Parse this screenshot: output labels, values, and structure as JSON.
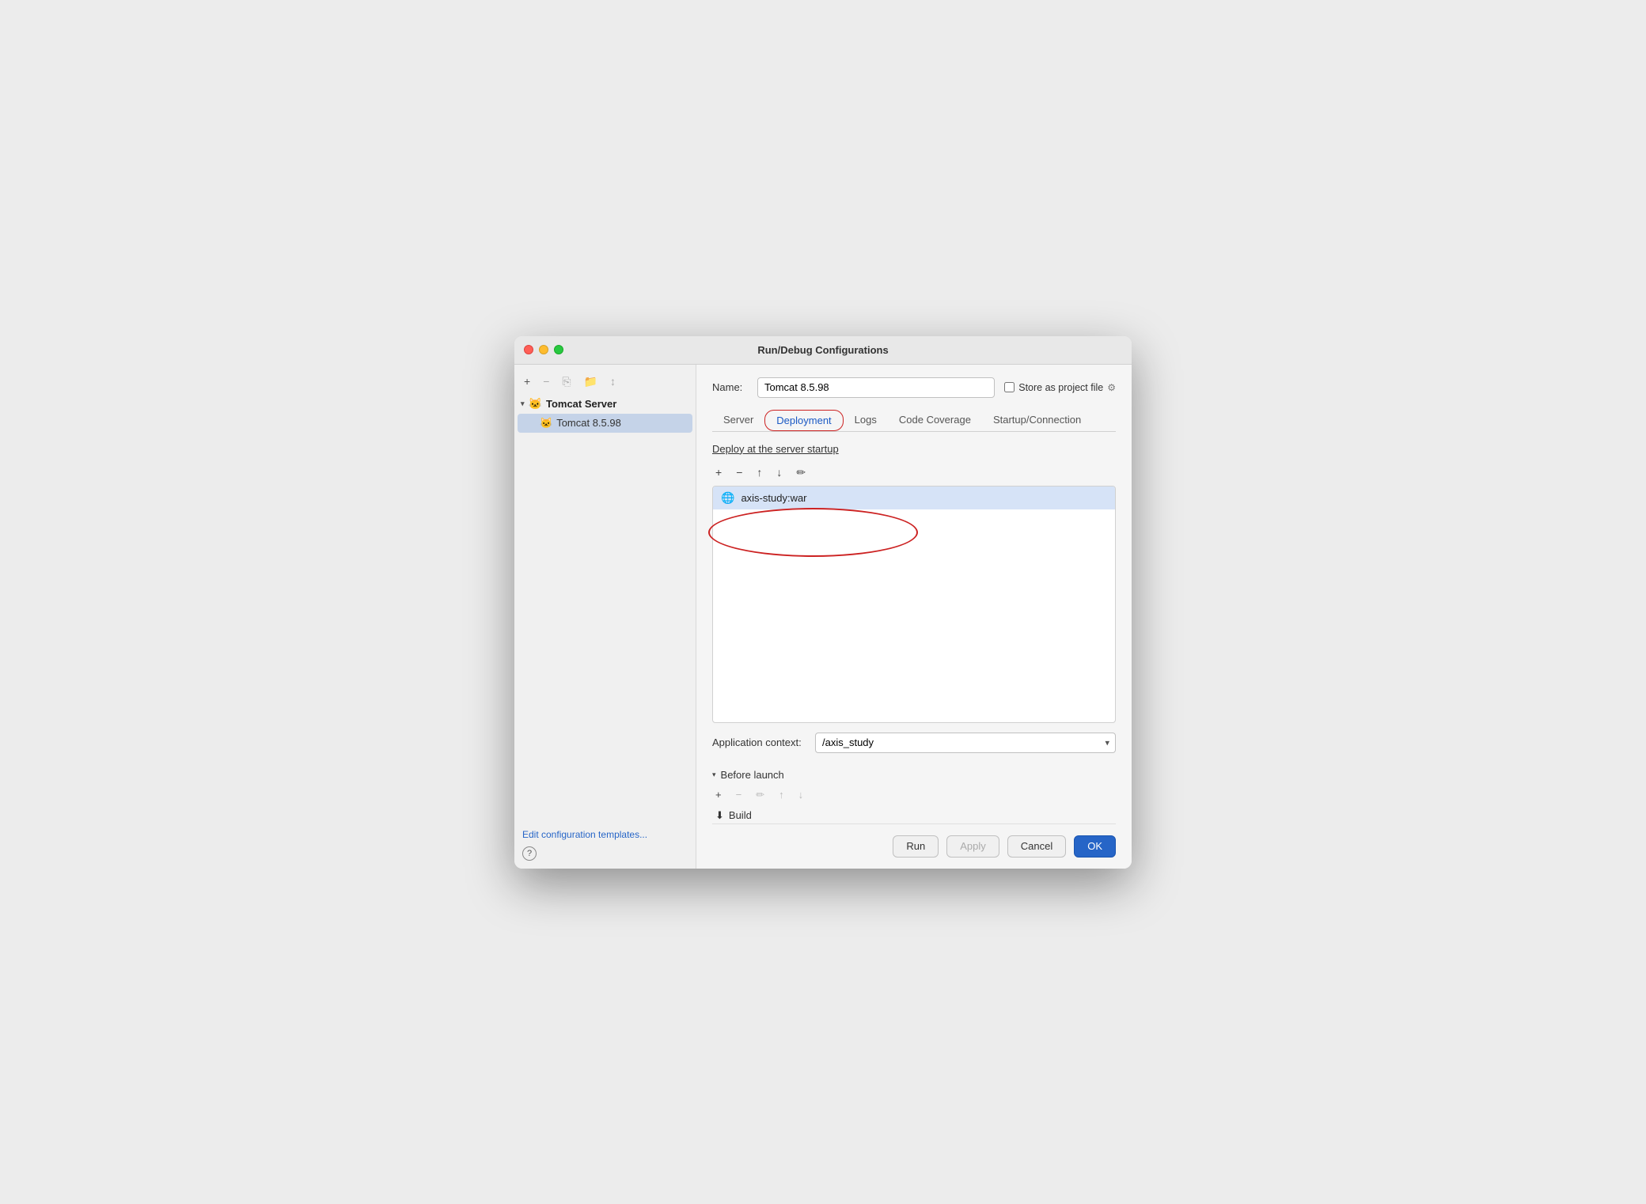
{
  "window": {
    "title": "Run/Debug Configurations"
  },
  "sidebar": {
    "group_label": "Tomcat Server",
    "item_label": "Tomcat 8.5.98",
    "toolbar": {
      "add": "+",
      "remove": "−",
      "copy": "⎘",
      "folder": "📁",
      "sort": "↕"
    },
    "footer_link": "Edit configuration templates...",
    "help_label": "?"
  },
  "header": {
    "name_label": "Name:",
    "name_value": "Tomcat 8.5.98",
    "store_label": "Store as project file",
    "store_checked": false
  },
  "tabs": [
    {
      "id": "server",
      "label": "Server",
      "active": false
    },
    {
      "id": "deployment",
      "label": "Deployment",
      "active": true
    },
    {
      "id": "logs",
      "label": "Logs",
      "active": false
    },
    {
      "id": "code-coverage",
      "label": "Code Coverage",
      "active": false
    },
    {
      "id": "startup-connection",
      "label": "Startup/Connection",
      "active": false
    }
  ],
  "deploy_section": {
    "title": "Deploy at the server startup",
    "toolbar": {
      "add": "+",
      "remove": "−",
      "move_up": "↑",
      "move_down": "↓",
      "edit": "✏"
    },
    "items": [
      {
        "icon": "🌐",
        "text": "axis-study:war"
      }
    ]
  },
  "context": {
    "label": "Application context:",
    "value": "/axis_study",
    "options": [
      "/axis_study"
    ]
  },
  "before_launch": {
    "title": "Before launch",
    "toolbar": {
      "add": "+",
      "remove": "−",
      "edit": "✏",
      "move_up": "↑",
      "move_down": "↓"
    },
    "items": [
      {
        "icon": "⬇",
        "text": "Build"
      }
    ]
  },
  "footer": {
    "run_label": "Run",
    "apply_label": "Apply",
    "cancel_label": "Cancel",
    "ok_label": "OK"
  }
}
